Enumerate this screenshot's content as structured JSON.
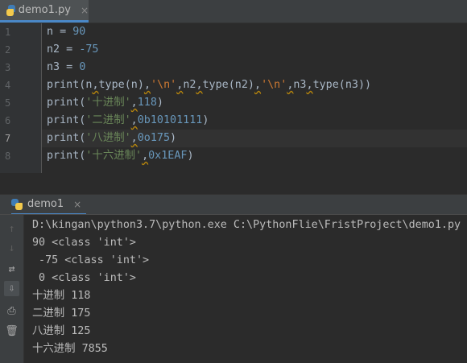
{
  "editor_tab": {
    "filename": "demo1.py",
    "close_glyph": "×"
  },
  "code_lines": [
    {
      "n": "1",
      "current": false,
      "tokens": [
        {
          "t": "n = ",
          "c": "fn"
        },
        {
          "t": "90",
          "c": "num"
        }
      ]
    },
    {
      "n": "2",
      "current": false,
      "tokens": [
        {
          "t": "n2 = ",
          "c": "fn"
        },
        {
          "t": "-75",
          "c": "num"
        }
      ]
    },
    {
      "n": "3",
      "current": false,
      "tokens": [
        {
          "t": "n3 = ",
          "c": "fn"
        },
        {
          "t": "0",
          "c": "num"
        }
      ]
    },
    {
      "n": "4",
      "current": false,
      "tokens": [
        {
          "t": "print(n",
          "c": "fn"
        },
        {
          "t": ",",
          "c": "fn",
          "sq": true
        },
        {
          "t": "type(n)",
          "c": "fn"
        },
        {
          "t": ",",
          "c": "fn",
          "sq": true
        },
        {
          "t": "'\\n'",
          "c": "esc"
        },
        {
          "t": ",",
          "c": "fn",
          "sq": true
        },
        {
          "t": "n2",
          "c": "fn"
        },
        {
          "t": ",",
          "c": "fn",
          "sq": true
        },
        {
          "t": "type(n2)",
          "c": "fn"
        },
        {
          "t": ",",
          "c": "fn",
          "sq": true
        },
        {
          "t": "'\\n'",
          "c": "esc"
        },
        {
          "t": ",",
          "c": "fn",
          "sq": true
        },
        {
          "t": "n3",
          "c": "fn"
        },
        {
          "t": ",",
          "c": "fn",
          "sq": true
        },
        {
          "t": "type(n3))",
          "c": "fn"
        }
      ]
    },
    {
      "n": "5",
      "current": false,
      "tokens": [
        {
          "t": "print(",
          "c": "fn"
        },
        {
          "t": "'十进制'",
          "c": "str"
        },
        {
          "t": ",",
          "c": "fn",
          "sq": true
        },
        {
          "t": "118",
          "c": "num"
        },
        {
          "t": ")",
          "c": "fn"
        }
      ]
    },
    {
      "n": "6",
      "current": false,
      "tokens": [
        {
          "t": "print(",
          "c": "fn"
        },
        {
          "t": "'二进制'",
          "c": "str"
        },
        {
          "t": ",",
          "c": "fn",
          "sq": true
        },
        {
          "t": "0b10101111",
          "c": "num"
        },
        {
          "t": ")",
          "c": "fn"
        }
      ]
    },
    {
      "n": "7",
      "current": true,
      "tokens": [
        {
          "t": "print(",
          "c": "fn"
        },
        {
          "t": "'八进制'",
          "c": "str"
        },
        {
          "t": ",",
          "c": "fn",
          "sq": true
        },
        {
          "t": "0o175",
          "c": "num"
        },
        {
          "t": ")",
          "c": "fn"
        }
      ]
    },
    {
      "n": "8",
      "current": false,
      "tokens": [
        {
          "t": "print(",
          "c": "fn"
        },
        {
          "t": "'十六进制'",
          "c": "str"
        },
        {
          "t": ",",
          "c": "fn",
          "sq": true
        },
        {
          "t": "0x1EAF",
          "c": "num"
        },
        {
          "t": ")",
          "c": "fn"
        }
      ]
    }
  ],
  "run_tab": {
    "label": "demo1",
    "close_glyph": "×"
  },
  "toolbar_icons": [
    "up-arrow-icon",
    "down-arrow-icon",
    "soft-wrap-icon",
    "scroll-to-end-icon",
    "print-icon",
    "trash-icon"
  ],
  "console_lines": [
    "D:\\kingan\\python3.7\\python.exe C:\\PythonFlie\\FristProject\\demo1.py",
    "90 <class 'int'>",
    " -75 <class 'int'>",
    " 0 <class 'int'>",
    "十进制 118",
    "二进制 175",
    "八进制 125",
    "十六进制 7855"
  ],
  "colors": {
    "background": "#2b2b2b",
    "number": "#6897bb",
    "string": "#6a8759",
    "escape": "#cc7832",
    "accent": "#4a88c7"
  }
}
